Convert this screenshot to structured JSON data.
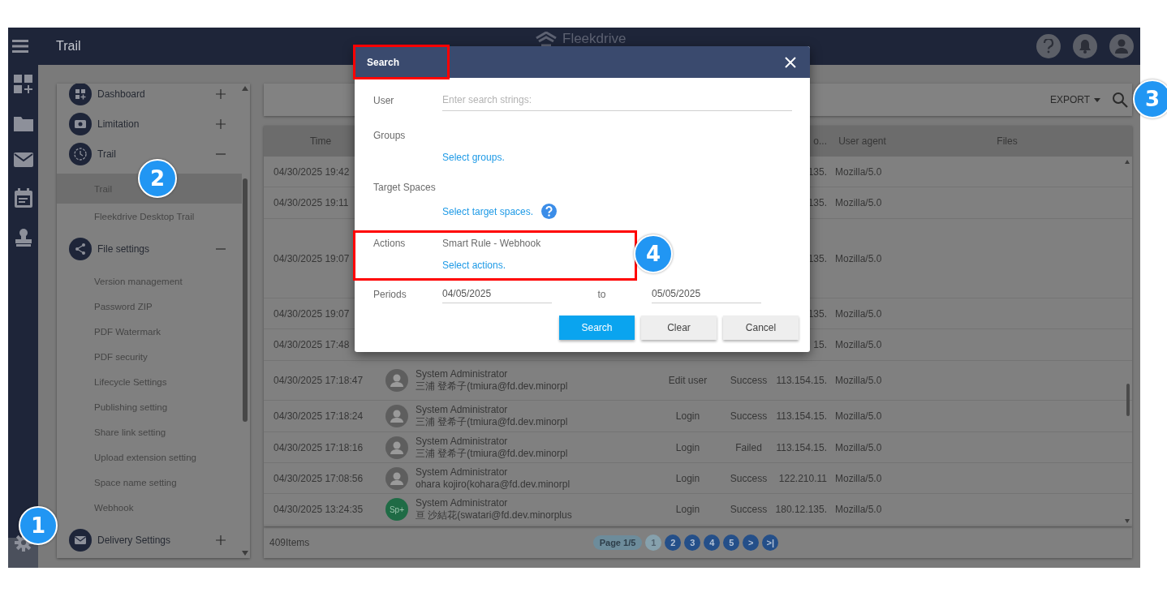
{
  "topbar": {
    "title": "Trail",
    "logo": "Fleekdrive"
  },
  "sidebar": {
    "groups": [
      {
        "label": "Dashboard",
        "expanded": false
      },
      {
        "label": "Limitation",
        "expanded": false
      },
      {
        "label": "Trail",
        "expanded": true,
        "children": [
          {
            "label": "Trail",
            "selected": true
          },
          {
            "label": "Fleekdrive Desktop Trail",
            "selected": false
          }
        ]
      },
      {
        "label": "File settings",
        "expanded": true,
        "children": [
          {
            "label": "Version management",
            "selected": false
          },
          {
            "label": "Password ZIP",
            "selected": false
          },
          {
            "label": "PDF Watermark",
            "selected": false
          },
          {
            "label": "PDF security",
            "selected": false
          },
          {
            "label": "Lifecycle Settings",
            "selected": false
          },
          {
            "label": "Publishing setting",
            "selected": false
          },
          {
            "label": "Share link setting",
            "selected": false
          },
          {
            "label": "Upload extension setting",
            "selected": false
          },
          {
            "label": "Space name setting",
            "selected": false
          },
          {
            "label": "Webhook",
            "selected": false
          }
        ]
      },
      {
        "label": "Delivery Settings",
        "expanded": false
      }
    ]
  },
  "toolbar": {
    "export": "EXPORT"
  },
  "table": {
    "columns": {
      "time": "Time",
      "column_5": "o...",
      "user_agent": "User agent",
      "files": "Files"
    },
    "rows": [
      {
        "time": "04/30/2025 19:42",
        "column_5": "135.",
        "user_agent": "Mozilla/5.0"
      },
      {
        "time": "04/30/2025 19:11",
        "column_5": "135.",
        "user_agent": "Mozilla/5.0"
      },
      {
        "time": "04/30/2025 19:07",
        "column_5": "135.",
        "user_agent": "Mozilla/5.0"
      },
      {
        "time": "04/30/2025 19:07",
        "column_5": "135.",
        "user_agent": "Mozilla/5.0"
      },
      {
        "time": "04/30/2025 17:48",
        "column_5": "15.",
        "user_agent": "Mozilla/5.0"
      },
      {
        "time": "04/30/2025 17:18:47",
        "avatar": {
          "kind": "person"
        },
        "user_role": "System Administrator",
        "user_name": "三浦 登希子(tmiura@fd.dev.minorpl",
        "action": "Edit user",
        "result": "Success",
        "column_5": "113.154.15.",
        "user_agent": "Mozilla/5.0"
      },
      {
        "time": "04/30/2025 17:18:24",
        "avatar": {
          "kind": "person"
        },
        "user_role": "System Administrator",
        "user_name": "三浦 登希子(tmiura@fd.dev.minorpl",
        "action": "Login",
        "result": "Success",
        "column_5": "113.154.15.",
        "user_agent": "Mozilla/5.0"
      },
      {
        "time": "04/30/2025 17:18:16",
        "avatar": {
          "kind": "person"
        },
        "user_role": "System Administrator",
        "user_name": "三浦 登希子(tmiura@fd.dev.minorpl",
        "action": "Login",
        "result": "Failed",
        "column_5": "113.154.15.",
        "user_agent": "Mozilla/5.0"
      },
      {
        "time": "04/30/2025 17:08:56",
        "avatar": {
          "kind": "person"
        },
        "user_role": "System Administrator",
        "user_name": "ohara kojiro(kohara@fd.dev.minorpl",
        "action": "Login",
        "result": "Success",
        "column_5": "122.210.11",
        "user_agent": "Mozilla/5.0"
      },
      {
        "time": "04/30/2025 13:24:35",
        "avatar": {
          "kind": "initials",
          "text": "Sp+"
        },
        "user_role": "System Administrator",
        "user_name": "亘 沙結花(swatari@fd.dev.minorplus",
        "action": "Login",
        "result": "Success",
        "column_5": "180.12.135.",
        "user_agent": "Mozilla/5.0"
      }
    ]
  },
  "footer": {
    "count": "409Items",
    "pager": {
      "label": "Page 1/5",
      "pages": [
        {
          "label": "1",
          "selected": true
        },
        {
          "label": "2",
          "selected": false
        },
        {
          "label": "3",
          "selected": false
        },
        {
          "label": "4",
          "selected": false
        },
        {
          "label": "5",
          "selected": false
        }
      ],
      "next": ">",
      "last": ">|"
    }
  },
  "dialog": {
    "title": "Search",
    "title_highlighted": true,
    "fields": [
      {
        "kind": "text",
        "label": "User",
        "placeholder": "Enter search strings:"
      },
      {
        "kind": "link",
        "label": "Groups",
        "link": "Select groups.",
        "help": false
      },
      {
        "kind": "link",
        "label": "Target Spaces",
        "link": "Select target spaces.",
        "help": true
      },
      {
        "kind": "value",
        "label": "Actions",
        "value": "Smart Rule - Webhook",
        "link": "Select actions.",
        "highlighted": true
      },
      {
        "kind": "period",
        "label": "Periods",
        "from": "04/05/2025",
        "separator": "to",
        "to": "05/05/2025"
      }
    ],
    "buttons": [
      {
        "label": "Search",
        "primary": true
      },
      {
        "label": "Clear",
        "primary": false
      },
      {
        "label": "Cancel",
        "primary": false
      }
    ]
  },
  "callouts": [
    {
      "label": "1"
    },
    {
      "label": "2"
    },
    {
      "label": "3"
    },
    {
      "label": "4"
    }
  ]
}
